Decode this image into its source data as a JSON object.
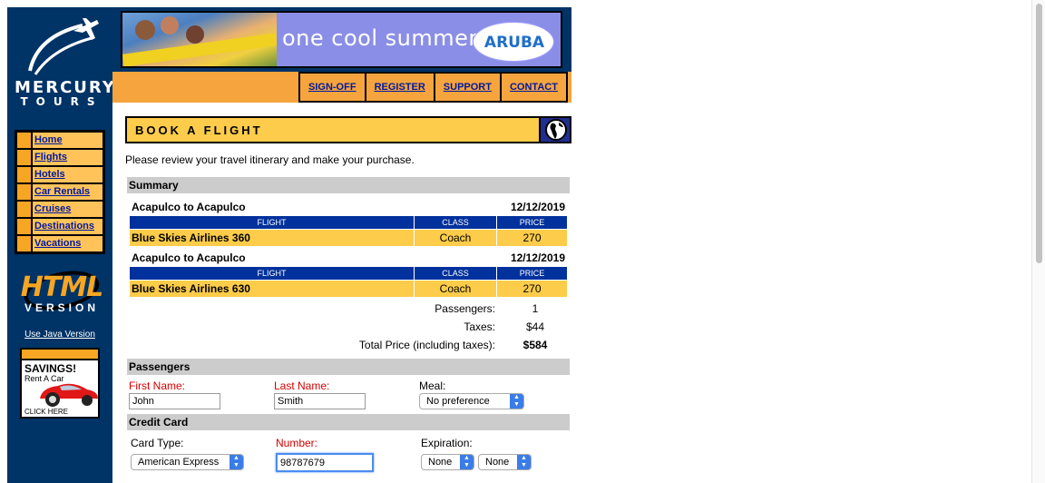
{
  "brand": {
    "name": "MERCURY",
    "sub": "TOURS"
  },
  "sidebar": {
    "items": [
      {
        "label": "Home"
      },
      {
        "label": "Flights"
      },
      {
        "label": "Hotels"
      },
      {
        "label": "Car Rentals"
      },
      {
        "label": "Cruises"
      },
      {
        "label": "Destinations"
      },
      {
        "label": "Vacations"
      }
    ],
    "html_version": {
      "big": "HTML",
      "sub": "VERSION"
    },
    "java_link": "Use Java Version",
    "ad": {
      "headline": "SAVINGS!",
      "line": "Rent A Car",
      "cta": "CLICK HERE"
    }
  },
  "banner": {
    "slogan": "one cool summer",
    "logo": "ARUBA"
  },
  "topnav": [
    "SIGN-OFF",
    "REGISTER",
    "SUPPORT",
    "CONTACT"
  ],
  "page": {
    "title": "BOOK A FLIGHT",
    "intro": "Please review your travel itinerary and make your purchase."
  },
  "summary": {
    "heading": "Summary",
    "columns": {
      "flight": "FLIGHT",
      "class": "CLASS",
      "price": "PRICE"
    },
    "legs": [
      {
        "route": "Acapulco to Acapulco",
        "date": "12/12/2019",
        "flight": "Blue Skies Airlines 360",
        "class": "Coach",
        "price": "270"
      },
      {
        "route": "Acapulco to Acapulco",
        "date": "12/12/2019",
        "flight": "Blue Skies Airlines 630",
        "class": "Coach",
        "price": "270"
      }
    ],
    "passengers_label": "Passengers:",
    "passengers": "1",
    "taxes_label": "Taxes:",
    "taxes": "$44",
    "total_label": "Total Price (including taxes):",
    "total": "$584"
  },
  "passengers": {
    "heading": "Passengers",
    "first_label": "First Name:",
    "first_value": "John",
    "last_label": "Last Name:",
    "last_value": "Smith",
    "meal_label": "Meal:",
    "meal_value": "No preference"
  },
  "credit_card": {
    "heading": "Credit Card",
    "type_label": "Card Type:",
    "type_value": "American Express",
    "number_label": "Number:",
    "number_value": "98787679",
    "exp_label": "Expiration:",
    "exp_month": "None",
    "exp_year": "None"
  },
  "colors": {
    "navy": "#003366",
    "orange": "#f5a43e",
    "gold": "#fccc4a",
    "table_header": "#00319c",
    "required": "#d40000"
  },
  "icons": [
    "plane-icon",
    "globe-icon",
    "car-icon",
    "select-arrows-icon"
  ]
}
